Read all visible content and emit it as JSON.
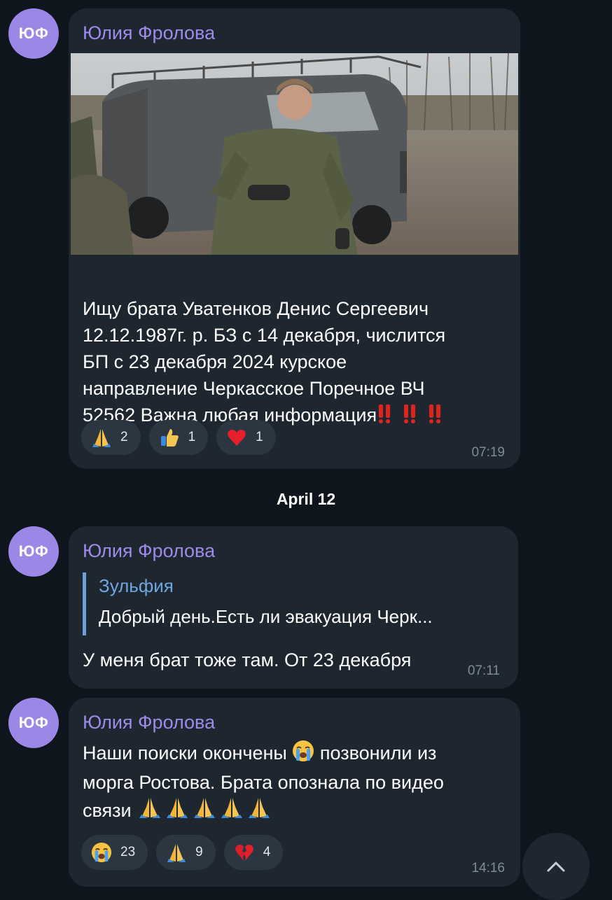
{
  "messages": [
    {
      "avatar_initials": "ЮФ",
      "sender": "Юлия Фролова",
      "photo": "soldier-near-military-van-photo",
      "text": "Ищу брата Уватенков Денис Сергеевич\n12.12.1987г. р. БЗ с 14 декабря, числится\nБП с 23 декабря 2024 курское\nнаправление Черкасское Поречное ВЧ\n52562 Важна любая информация",
      "text_suffix_icons": [
        "double-exclamation-icon",
        "double-exclamation-icon",
        "double-exclamation-icon"
      ],
      "reactions": [
        {
          "icon": "folded-hands-icon",
          "count": "2"
        },
        {
          "icon": "thumbs-up-icon",
          "count": "1"
        },
        {
          "icon": "red-heart-icon",
          "count": "1"
        }
      ],
      "time": "07:19"
    },
    {
      "avatar_initials": "ЮФ",
      "sender": "Юлия Фролова",
      "reply": {
        "author": "Зульфия",
        "text": "Добрый день.Есть ли эвакуация Черк..."
      },
      "text": "У меня брат тоже там. От 23 декабря",
      "time": "07:11"
    },
    {
      "avatar_initials": "ЮФ",
      "sender": "Юлия Фролова",
      "text_line1": "Наши поиски окончены",
      "text_line1_after": " позвонили из",
      "text_line2": "морга Ростова. Брата опознала по видео",
      "text_line3": "связи",
      "inline_icons": [
        "loudly-crying-face-icon",
        "folded-hands-icon"
      ],
      "reactions": [
        {
          "icon": "loudly-crying-face-icon",
          "count": "23"
        },
        {
          "icon": "folded-hands-icon",
          "count": "9"
        },
        {
          "icon": "broken-heart-icon",
          "count": "4"
        }
      ],
      "time": "14:16"
    }
  ],
  "date_separator": "April 12",
  "scroll_button_icon": "chevron-up-icon",
  "colors": {
    "background": "#0f151c",
    "bubble": "#1e2730",
    "sender_name": "#9c8be8",
    "avatar": "#9b87e6",
    "reply_author": "#6fa6e0",
    "time": "#7e8a97"
  }
}
